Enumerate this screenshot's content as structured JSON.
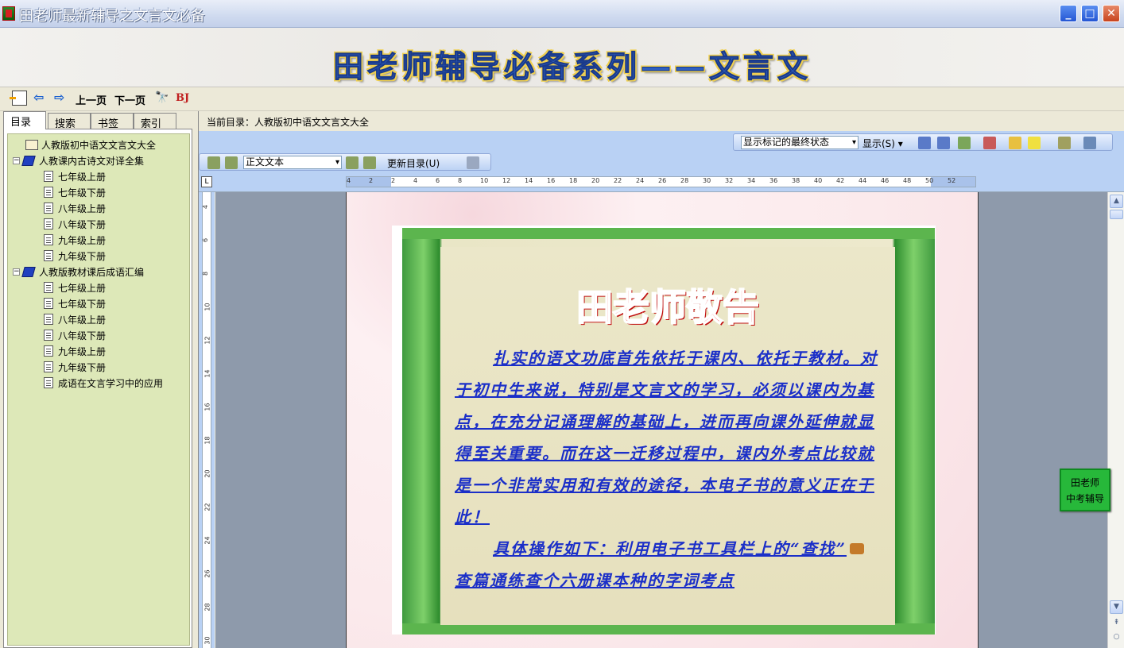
{
  "window": {
    "title": "田老师最新辅导之文言文必备",
    "min": "_",
    "max": "□",
    "close": "✕"
  },
  "banner": {
    "title": "田老师辅导必备系列——文言文"
  },
  "navbar": {
    "back_icon": "⇦",
    "forward_icon": "⇨",
    "prev": "上一页",
    "next": "下一页",
    "find_icon": "🔭",
    "bj": "BJ"
  },
  "sidebar": {
    "tabs": [
      "目录",
      "搜索",
      "书签",
      "索引"
    ],
    "tree": {
      "root": "人教版初中语文文言文大全",
      "groups": [
        {
          "label": "人教课内古诗文对译全集",
          "exp": "−",
          "children": [
            "七年级上册",
            "七年级下册",
            "八年级上册",
            "八年级下册",
            "九年级上册",
            "九年级下册"
          ]
        },
        {
          "label": "人教版教材课后成语汇编",
          "exp": "−",
          "children": [
            "七年级上册",
            "七年级下册",
            "八年级上册",
            "八年级下册",
            "九年级上册",
            "九年级下册",
            "成语在文言学习中的应用"
          ]
        }
      ]
    }
  },
  "main": {
    "current_dir": "当前目录：人教版初中语文文言文大全",
    "track": {
      "markup_select": "显示标记的最终状态",
      "show_menu": "显示(S) ▾"
    },
    "std": {
      "style_select": "正文文本",
      "update_toc": "更新目录(U)"
    },
    "ruler_labels": [
      "4",
      "2",
      "2",
      "4",
      "6",
      "8",
      "10",
      "12",
      "14",
      "16",
      "18",
      "20",
      "22",
      "24",
      "26",
      "28",
      "30",
      "32",
      "34",
      "36",
      "38",
      "40",
      "42",
      "44",
      "46",
      "48",
      "50",
      "52"
    ],
    "vruler_labels": [
      "4",
      "6",
      "8",
      "10",
      "12",
      "14",
      "16",
      "18",
      "20",
      "22",
      "24",
      "26",
      "28",
      "30"
    ],
    "notice": {
      "title": "田老师敬告",
      "para1": "扎实的语文功底首先依托于课内、依托于教材。对于初中生来说，特别是文言文的学习，必须以课内为基点，在充分记诵理解的基础上，进而再向课外延伸就显得至关重要。而在这一迁移过程中，课内外考点比较就是一个非常实用和有效的途径，本电子书的意义正在于此！",
      "para2a": "具体操作如下：利用电子书工具栏上的“查找”",
      "para2b": "查篇通练查个六册课本种的字词考点"
    },
    "scroll": {
      "up": "▲",
      "down": "▼",
      "prev_browse": "⇞",
      "select_browse": "○"
    }
  },
  "float_button": {
    "line1": "田老师",
    "line2": "中考辅导"
  }
}
